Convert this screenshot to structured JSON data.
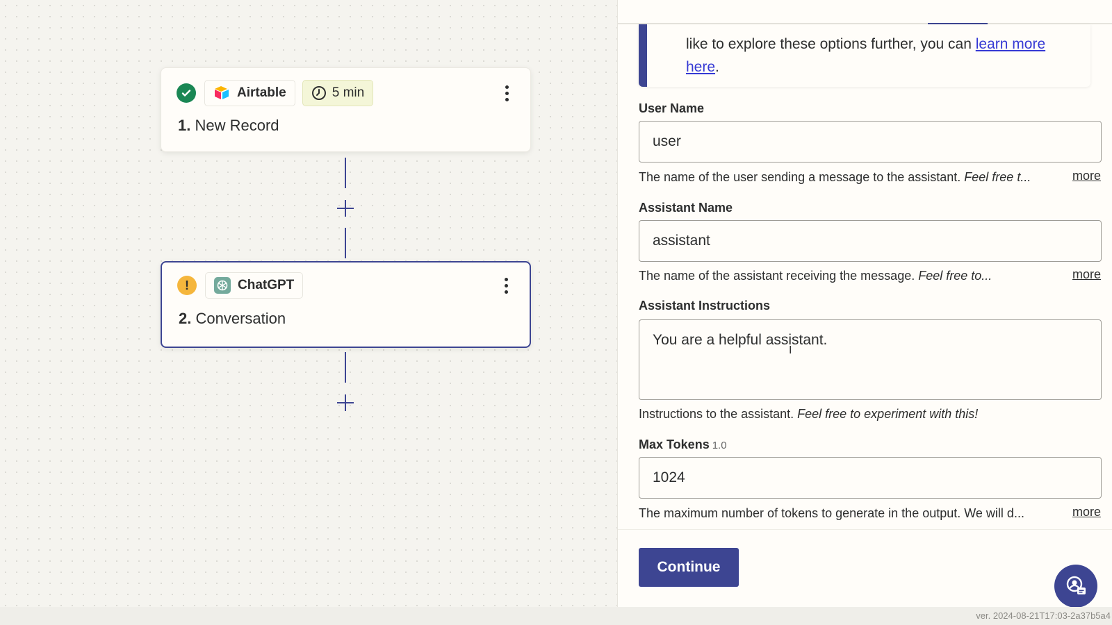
{
  "canvas": {
    "steps": [
      {
        "status": "success",
        "status_icon": "check-icon",
        "app_name": "Airtable",
        "app_icon": "airtable-logo-icon",
        "time_label": "5 min",
        "number": "1.",
        "title": "New Record"
      },
      {
        "status": "warning",
        "status_icon": "warning-icon",
        "status_glyph": "!",
        "app_name": "ChatGPT",
        "app_icon": "chatgpt-logo-icon",
        "number": "2.",
        "title": "Conversation"
      }
    ]
  },
  "panel": {
    "notice": {
      "text": "like to explore these options further, you can ",
      "link_text": "learn more here",
      "suffix": "."
    },
    "fields": [
      {
        "label": "User Name",
        "value": "user",
        "help": "The name of the user sending a message to the assistant. ",
        "help_italic": "Feel free t...",
        "more": "more"
      },
      {
        "label": "Assistant Name",
        "value": "assistant",
        "help": "The name of the assistant receiving the message. ",
        "help_italic": "Feel free to...",
        "more": "more"
      },
      {
        "label": "Assistant Instructions",
        "value": "You are a helpful assistant.",
        "help": "Instructions to the assistant. ",
        "help_italic": "Feel free to experiment with this!"
      },
      {
        "label": "Max Tokens",
        "version": "1.0",
        "value": "1024",
        "help": "The maximum number of tokens to generate in the output. We will d...",
        "more": "more"
      }
    ],
    "continue_label": "Continue",
    "help_icon": "chat-support-icon"
  },
  "footer": {
    "version": "ver. 2024-08-21T17:03-2a37b5a4"
  },
  "colors": {
    "accent": "#3d4592",
    "success": "#1a8754",
    "warning": "#f5b63c",
    "link": "#3539d4"
  }
}
